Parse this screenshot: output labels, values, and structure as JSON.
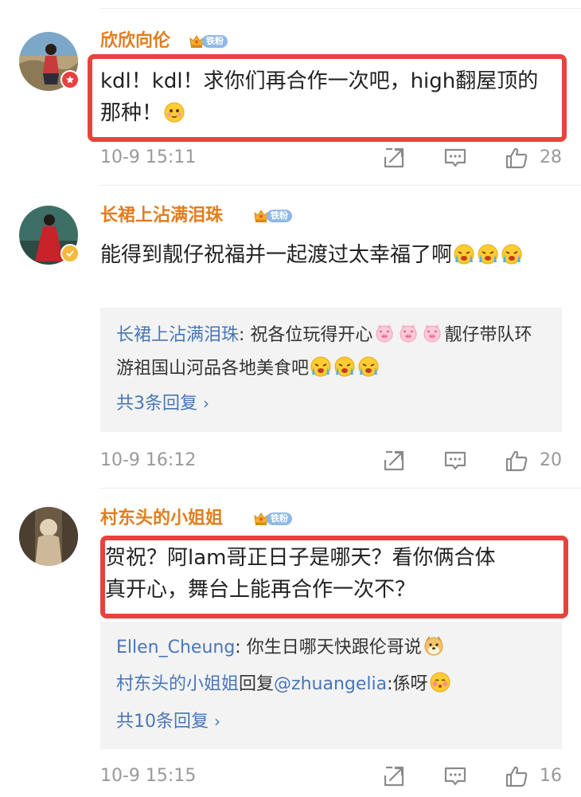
{
  "comments": [
    {
      "username": "欣欣向伦",
      "fan_badge": "铁粉",
      "text": "kdl！kdl！求你们再合作一次吧，high翻屋顶的那种！",
      "time": "10-9 15:11",
      "likes": "28"
    },
    {
      "username": "长裙上沾满泪珠",
      "fan_badge": "铁粉",
      "text": "能得到靓仔祝福并一起渡过太幸福了啊",
      "reply": {
        "author": "长裙上沾满泪珠",
        "sep": ": ",
        "text": "祝各位玩得开心",
        "text2": "靓仔带队环游祖国山河品各地美食吧",
        "more": "共3条回复"
      },
      "time": "10-9 16:12",
      "likes": "20"
    },
    {
      "username": "村东头的小姐姐",
      "fan_badge": "铁粉",
      "text_line1": "贺祝？阿lam哥正日子是哪天？看你俩合体",
      "text_line2": "真开心，舞台上能再合作一次不？",
      "replies": [
        {
          "author": "Ellen_Cheung",
          "sep": ": ",
          "text": "你生日哪天快跟伦哥说"
        },
        {
          "author": "村东头的小姐姐",
          "mid": "回复",
          "mention": "@zhuangelia",
          "text": ":係呀"
        }
      ],
      "more": "共10条回复",
      "time": "10-9 15:15",
      "likes": "16"
    }
  ],
  "colors": {
    "username": "#e27d1f",
    "link": "#4876b8",
    "highlight_box": "#e5443d",
    "meta": "#999999"
  },
  "icons": [
    "share-icon",
    "comment-icon",
    "like-icon",
    "crown-icon",
    "verified-badge-icon"
  ]
}
